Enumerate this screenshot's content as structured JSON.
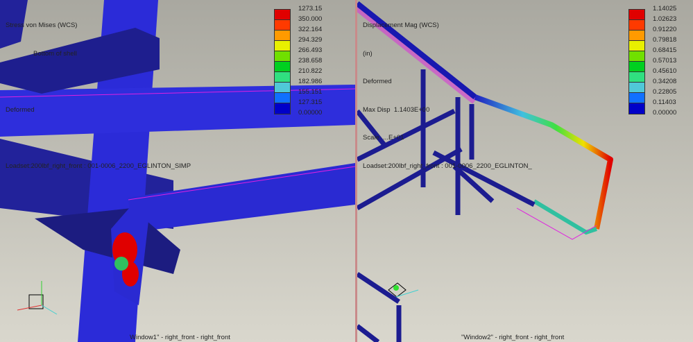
{
  "window1": {
    "info_lines": [
      "Stress von Mises (WCS)",
      "Bottom of shell",
      "",
      "Deformed",
      "",
      "Loadset:200lbf_right_front : 001-0006_2200_EGLINTON_SIMP"
    ],
    "legend_labels": [
      "1273.15",
      "350.000",
      "322.164",
      "294.329",
      "266.493",
      "238.658",
      "210.822",
      "182.986",
      "155.151",
      "127.315",
      "0.00000"
    ],
    "title": "Window1\" - right_front - right_front"
  },
  "window2": {
    "info_lines": [
      "Displacement Mag (WCS)",
      "(in)",
      "Deformed",
      "Max Disp  1.1403E+00",
      "Scale  ...E+01",
      "Loadset:200lbf_right_front : 001-0006_2200_EGLINTON_"
    ],
    "legend_labels": [
      "1.14025",
      "1.02623",
      "0.91220",
      "0.79818",
      "0.68415",
      "0.57013",
      "0.45610",
      "0.34208",
      "0.22805",
      "0.11403",
      "0.00000"
    ],
    "title": "\"Window2\" - right_front - right_front"
  },
  "legend_colors": [
    "#e00000",
    "#ff3a00",
    "#ff9a00",
    "#e8f000",
    "#70e000",
    "#00d020",
    "#30e080",
    "#50c8d8",
    "#1070ff",
    "#0000c8",
    "#10107a"
  ],
  "colors": {
    "structure": "#2a2ad0",
    "outline": "#e020e0",
    "separator": "#c98a8a"
  }
}
